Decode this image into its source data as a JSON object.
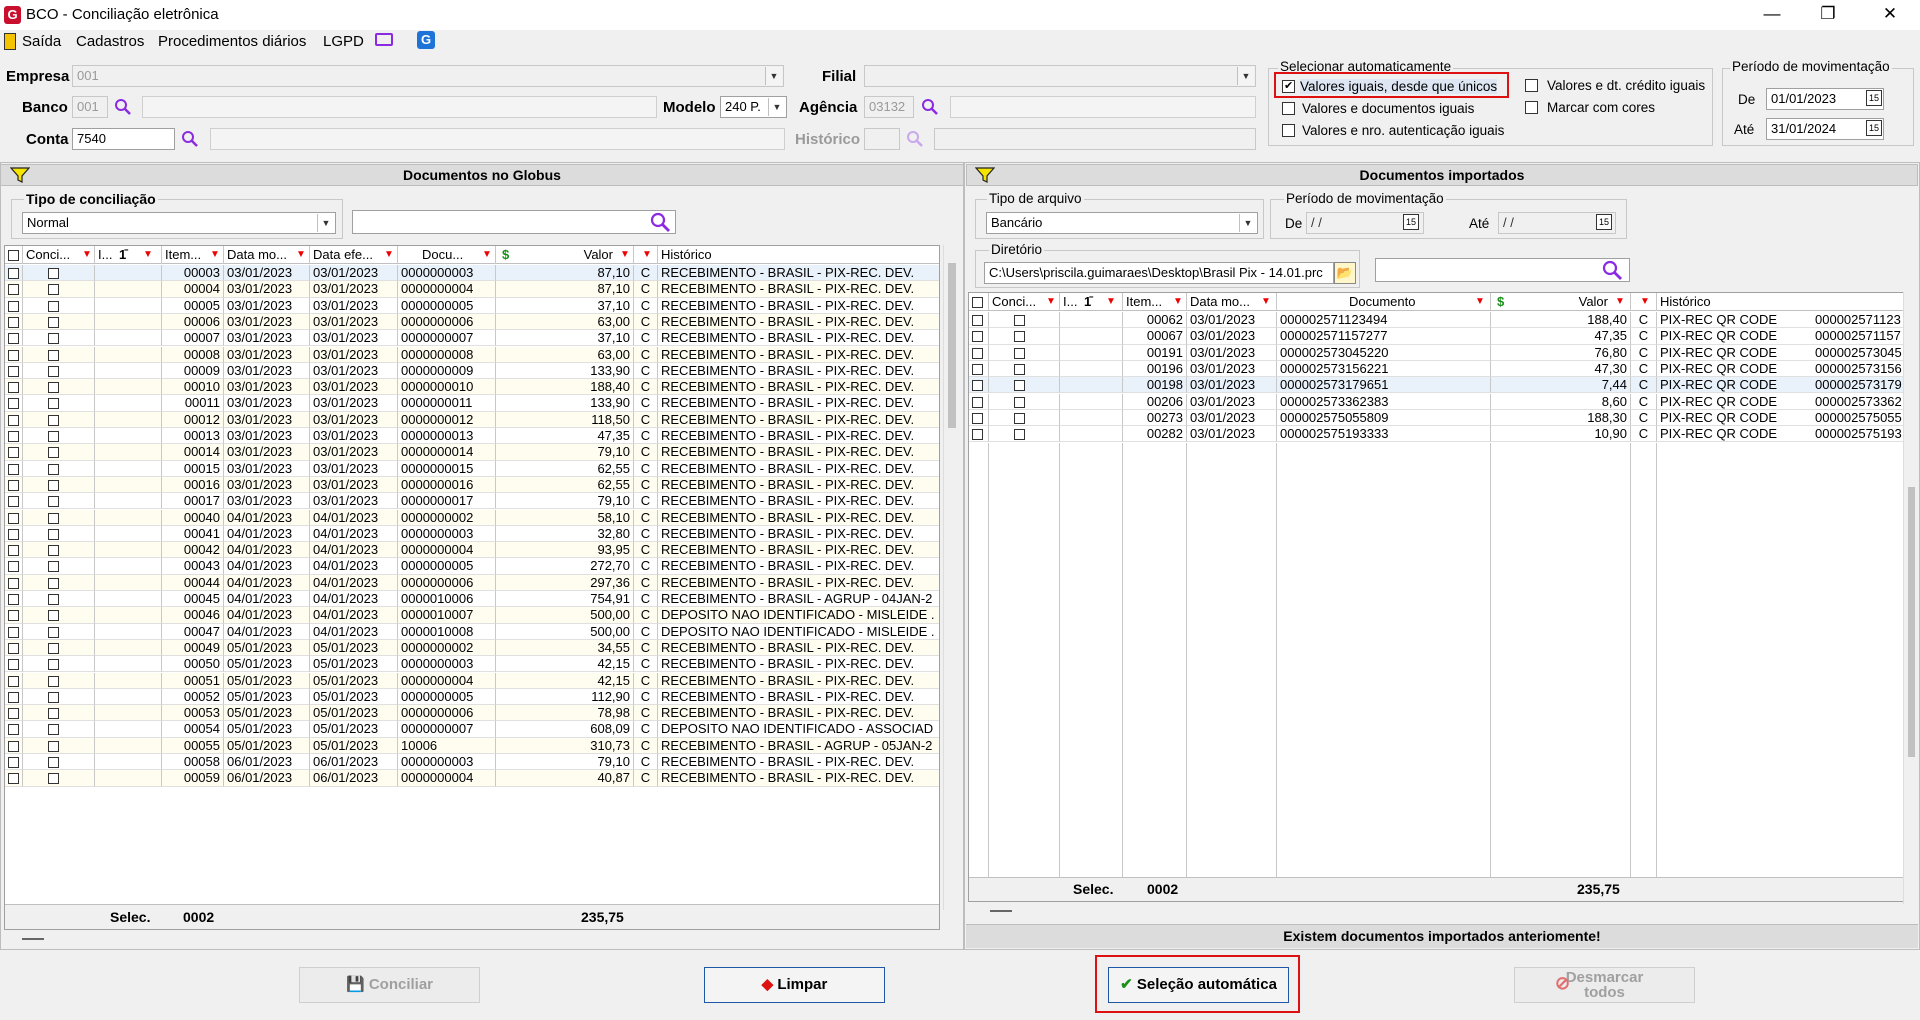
{
  "window": {
    "title": "BCO - Conciliação eletrônica",
    "min": "—",
    "max": "❐",
    "close": "✕"
  },
  "menu": {
    "items": [
      "Saída",
      "Cadastros",
      "Procedimentos diários",
      "LGPD"
    ]
  },
  "form": {
    "empresa_label": "Empresa",
    "empresa_code": "001",
    "banco_label": "Banco",
    "banco_code": "001",
    "conta_label": "Conta",
    "conta_value": "7540",
    "modelo_label": "Modelo",
    "modelo_value": "240 P.",
    "filial_label": "Filial",
    "agencia_label": "Agência",
    "agencia_value": "03132",
    "historico_label": "Histórico"
  },
  "auto_select": {
    "title": "Selecionar automaticamente",
    "options": [
      {
        "label": "Valores iguais, desde que únicos",
        "checked": true
      },
      {
        "label": "Valores e documentos iguais",
        "checked": false
      },
      {
        "label": "Valores e nro. autenticação iguais",
        "checked": false
      },
      {
        "label": "Valores e dt. crédito iguais",
        "checked": false
      },
      {
        "label": "Marcar com cores",
        "checked": false
      }
    ]
  },
  "periodo": {
    "title": "Período de movimentação",
    "de_label": "De",
    "de_value": "01/01/2023",
    "ate_label": "Até",
    "ate_value": "31/01/2024"
  },
  "left_panel": {
    "title": "Documentos no Globus",
    "tipo_label": "Tipo de conciliação",
    "tipo_value": "Normal",
    "columns": [
      "Conci...",
      "I...",
      "Item...",
      "Data mo...",
      "Data efe...",
      "Docu...",
      "Valor",
      "",
      "Histórico"
    ],
    "rows": [
      [
        "00003",
        "03/01/2023",
        "03/01/2023",
        "0000000003",
        "87,10",
        "C",
        "RECEBIMENTO - BRASIL - PIX-REC. DEV."
      ],
      [
        "00004",
        "03/01/2023",
        "03/01/2023",
        "0000000004",
        "87,10",
        "C",
        "RECEBIMENTO - BRASIL - PIX-REC. DEV."
      ],
      [
        "00005",
        "03/01/2023",
        "03/01/2023",
        "0000000005",
        "37,10",
        "C",
        "RECEBIMENTO - BRASIL - PIX-REC. DEV."
      ],
      [
        "00006",
        "03/01/2023",
        "03/01/2023",
        "0000000006",
        "63,00",
        "C",
        "RECEBIMENTO - BRASIL - PIX-REC. DEV."
      ],
      [
        "00007",
        "03/01/2023",
        "03/01/2023",
        "0000000007",
        "37,10",
        "C",
        "RECEBIMENTO - BRASIL - PIX-REC. DEV."
      ],
      [
        "00008",
        "03/01/2023",
        "03/01/2023",
        "0000000008",
        "63,00",
        "C",
        "RECEBIMENTO - BRASIL - PIX-REC. DEV."
      ],
      [
        "00009",
        "03/01/2023",
        "03/01/2023",
        "0000000009",
        "133,90",
        "C",
        "RECEBIMENTO - BRASIL - PIX-REC. DEV."
      ],
      [
        "00010",
        "03/01/2023",
        "03/01/2023",
        "0000000010",
        "188,40",
        "C",
        "RECEBIMENTO - BRASIL - PIX-REC. DEV."
      ],
      [
        "00011",
        "03/01/2023",
        "03/01/2023",
        "0000000011",
        "133,90",
        "C",
        "RECEBIMENTO - BRASIL - PIX-REC. DEV."
      ],
      [
        "00012",
        "03/01/2023",
        "03/01/2023",
        "0000000012",
        "118,50",
        "C",
        "RECEBIMENTO - BRASIL - PIX-REC. DEV."
      ],
      [
        "00013",
        "03/01/2023",
        "03/01/2023",
        "0000000013",
        "47,35",
        "C",
        "RECEBIMENTO - BRASIL - PIX-REC. DEV."
      ],
      [
        "00014",
        "03/01/2023",
        "03/01/2023",
        "0000000014",
        "79,10",
        "C",
        "RECEBIMENTO - BRASIL - PIX-REC. DEV."
      ],
      [
        "00015",
        "03/01/2023",
        "03/01/2023",
        "0000000015",
        "62,55",
        "C",
        "RECEBIMENTO - BRASIL - PIX-REC. DEV."
      ],
      [
        "00016",
        "03/01/2023",
        "03/01/2023",
        "0000000016",
        "62,55",
        "C",
        "RECEBIMENTO - BRASIL - PIX-REC. DEV."
      ],
      [
        "00017",
        "03/01/2023",
        "03/01/2023",
        "0000000017",
        "79,10",
        "C",
        "RECEBIMENTO - BRASIL - PIX-REC. DEV."
      ],
      [
        "00040",
        "04/01/2023",
        "04/01/2023",
        "0000000002",
        "58,10",
        "C",
        "RECEBIMENTO - BRASIL - PIX-REC. DEV."
      ],
      [
        "00041",
        "04/01/2023",
        "04/01/2023",
        "0000000003",
        "32,80",
        "C",
        "RECEBIMENTO - BRASIL - PIX-REC. DEV."
      ],
      [
        "00042",
        "04/01/2023",
        "04/01/2023",
        "0000000004",
        "93,95",
        "C",
        "RECEBIMENTO - BRASIL - PIX-REC. DEV."
      ],
      [
        "00043",
        "04/01/2023",
        "04/01/2023",
        "0000000005",
        "272,70",
        "C",
        "RECEBIMENTO - BRASIL - PIX-REC. DEV."
      ],
      [
        "00044",
        "04/01/2023",
        "04/01/2023",
        "0000000006",
        "297,36",
        "C",
        "RECEBIMENTO - BRASIL - PIX-REC. DEV."
      ],
      [
        "00045",
        "04/01/2023",
        "04/01/2023",
        "0000010006",
        "754,91",
        "C",
        "RECEBIMENTO - BRASIL - AGRUP - 04JAN-2"
      ],
      [
        "00046",
        "04/01/2023",
        "04/01/2023",
        "0000010007",
        "500,00",
        "C",
        "DEPOSITO NAO IDENTIFICADO - MISLEIDE ."
      ],
      [
        "00047",
        "04/01/2023",
        "04/01/2023",
        "0000010008",
        "500,00",
        "C",
        "DEPOSITO NAO IDENTIFICADO - MISLEIDE ."
      ],
      [
        "00049",
        "05/01/2023",
        "05/01/2023",
        "0000000002",
        "34,55",
        "C",
        "RECEBIMENTO - BRASIL - PIX-REC. DEV."
      ],
      [
        "00050",
        "05/01/2023",
        "05/01/2023",
        "0000000003",
        "42,15",
        "C",
        "RECEBIMENTO - BRASIL - PIX-REC. DEV."
      ],
      [
        "00051",
        "05/01/2023",
        "05/01/2023",
        "0000000004",
        "42,15",
        "C",
        "RECEBIMENTO - BRASIL - PIX-REC. DEV."
      ],
      [
        "00052",
        "05/01/2023",
        "05/01/2023",
        "0000000005",
        "112,90",
        "C",
        "RECEBIMENTO - BRASIL - PIX-REC. DEV."
      ],
      [
        "00053",
        "05/01/2023",
        "05/01/2023",
        "0000000006",
        "78,98",
        "C",
        "RECEBIMENTO - BRASIL - PIX-REC. DEV."
      ],
      [
        "00054",
        "05/01/2023",
        "05/01/2023",
        "0000000007",
        "608,09",
        "C",
        "DEPOSITO NAO IDENTIFICADO - ASSOCIAD"
      ],
      [
        "00055",
        "05/01/2023",
        "05/01/2023",
        "10006",
        "310,73",
        "C",
        "RECEBIMENTO - BRASIL - AGRUP - 05JAN-2"
      ],
      [
        "00058",
        "06/01/2023",
        "06/01/2023",
        "0000000003",
        "79,10",
        "C",
        "RECEBIMENTO - BRASIL - PIX-REC. DEV."
      ],
      [
        "00059",
        "06/01/2023",
        "06/01/2023",
        "0000000004",
        "40,87",
        "C",
        "RECEBIMENTO - BRASIL - PIX-REC. DEV."
      ]
    ],
    "footer_label": "Selec.",
    "footer_count": "0002",
    "footer_total": "235,75"
  },
  "right_panel": {
    "title": "Documentos importados",
    "tipo_label": "Tipo de arquivo",
    "tipo_value": "Bancário",
    "periodo_label": "Período de movimentação",
    "de_label": "De",
    "de_value": " / /",
    "ate_label": "Até",
    "ate_value": " / /",
    "diretorio_label": "Diretório",
    "diretorio_value": "C:\\Users\\priscila.guimaraes\\Desktop\\Brasil Pix - 14.01.prc",
    "columns": [
      "Conci...",
      "I...",
      "Item...",
      "Data mo...",
      "Documento",
      "Valor",
      "",
      "Histórico"
    ],
    "rows": [
      [
        "00062",
        "03/01/2023",
        "000002571123494",
        "188,40",
        "C",
        "PIX-REC QR CODE",
        "000002571123"
      ],
      [
        "00067",
        "03/01/2023",
        "000002571157277",
        "47,35",
        "C",
        "PIX-REC QR CODE",
        "000002571157"
      ],
      [
        "00191",
        "03/01/2023",
        "000002573045220",
        "76,80",
        "C",
        "PIX-REC QR CODE",
        "000002573045"
      ],
      [
        "00196",
        "03/01/2023",
        "000002573156221",
        "47,30",
        "C",
        "PIX-REC QR CODE",
        "000002573156"
      ],
      [
        "00198",
        "03/01/2023",
        "000002573179651",
        "7,44",
        "C",
        "PIX-REC QR CODE",
        "000002573179"
      ],
      [
        "00206",
        "03/01/2023",
        "000002573362383",
        "8,60",
        "C",
        "PIX-REC QR CODE",
        "000002573362"
      ],
      [
        "00273",
        "03/01/2023",
        "000002575055809",
        "188,30",
        "C",
        "PIX-REC QR CODE",
        "000002575055"
      ],
      [
        "00282",
        "03/01/2023",
        "000002575193333",
        "10,90",
        "C",
        "PIX-REC QR CODE",
        "000002575193"
      ]
    ],
    "footer_label": "Selec.",
    "footer_count": "0002",
    "footer_total": "235,75",
    "status": "Existem documentos importados anteriomente!"
  },
  "buttons": {
    "conciliar": "Conciliar",
    "limpar": "Limpar",
    "selecao": "Seleção automática",
    "desmarcar1": "Desmarcar",
    "desmarcar2": "todos"
  }
}
